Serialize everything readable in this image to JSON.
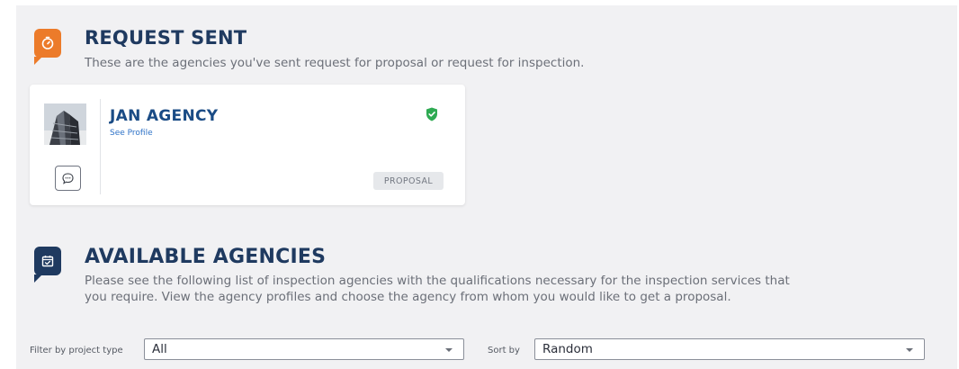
{
  "request_sent": {
    "title": "REQUEST SENT",
    "description": "These are the agencies you've sent request for proposal or request for inspection.",
    "icon": "timer-icon"
  },
  "agency_card": {
    "name": "JAN AGENCY",
    "see_profile": "See Profile",
    "tag": "PROPOSAL",
    "verified_color": "#2eaa52",
    "avatar": "building-photo"
  },
  "available_agencies": {
    "title": "AVAILABLE AGENCIES",
    "description_line1": "Please see the following list of inspection agencies with the qualifications necessary for the inspection services that",
    "description_line2": "you require. View the agency profiles and choose the agency from whom you would like to get a proposal.",
    "icon": "calendar-check-icon"
  },
  "filters": {
    "project_type_label": "Filter by project type",
    "project_type_value": "All",
    "sort_label": "Sort by",
    "sort_value": "Random"
  },
  "colors": {
    "accent_orange": "#ec7b2a",
    "navy": "#1f3a60",
    "link_blue": "#2e72c7"
  }
}
